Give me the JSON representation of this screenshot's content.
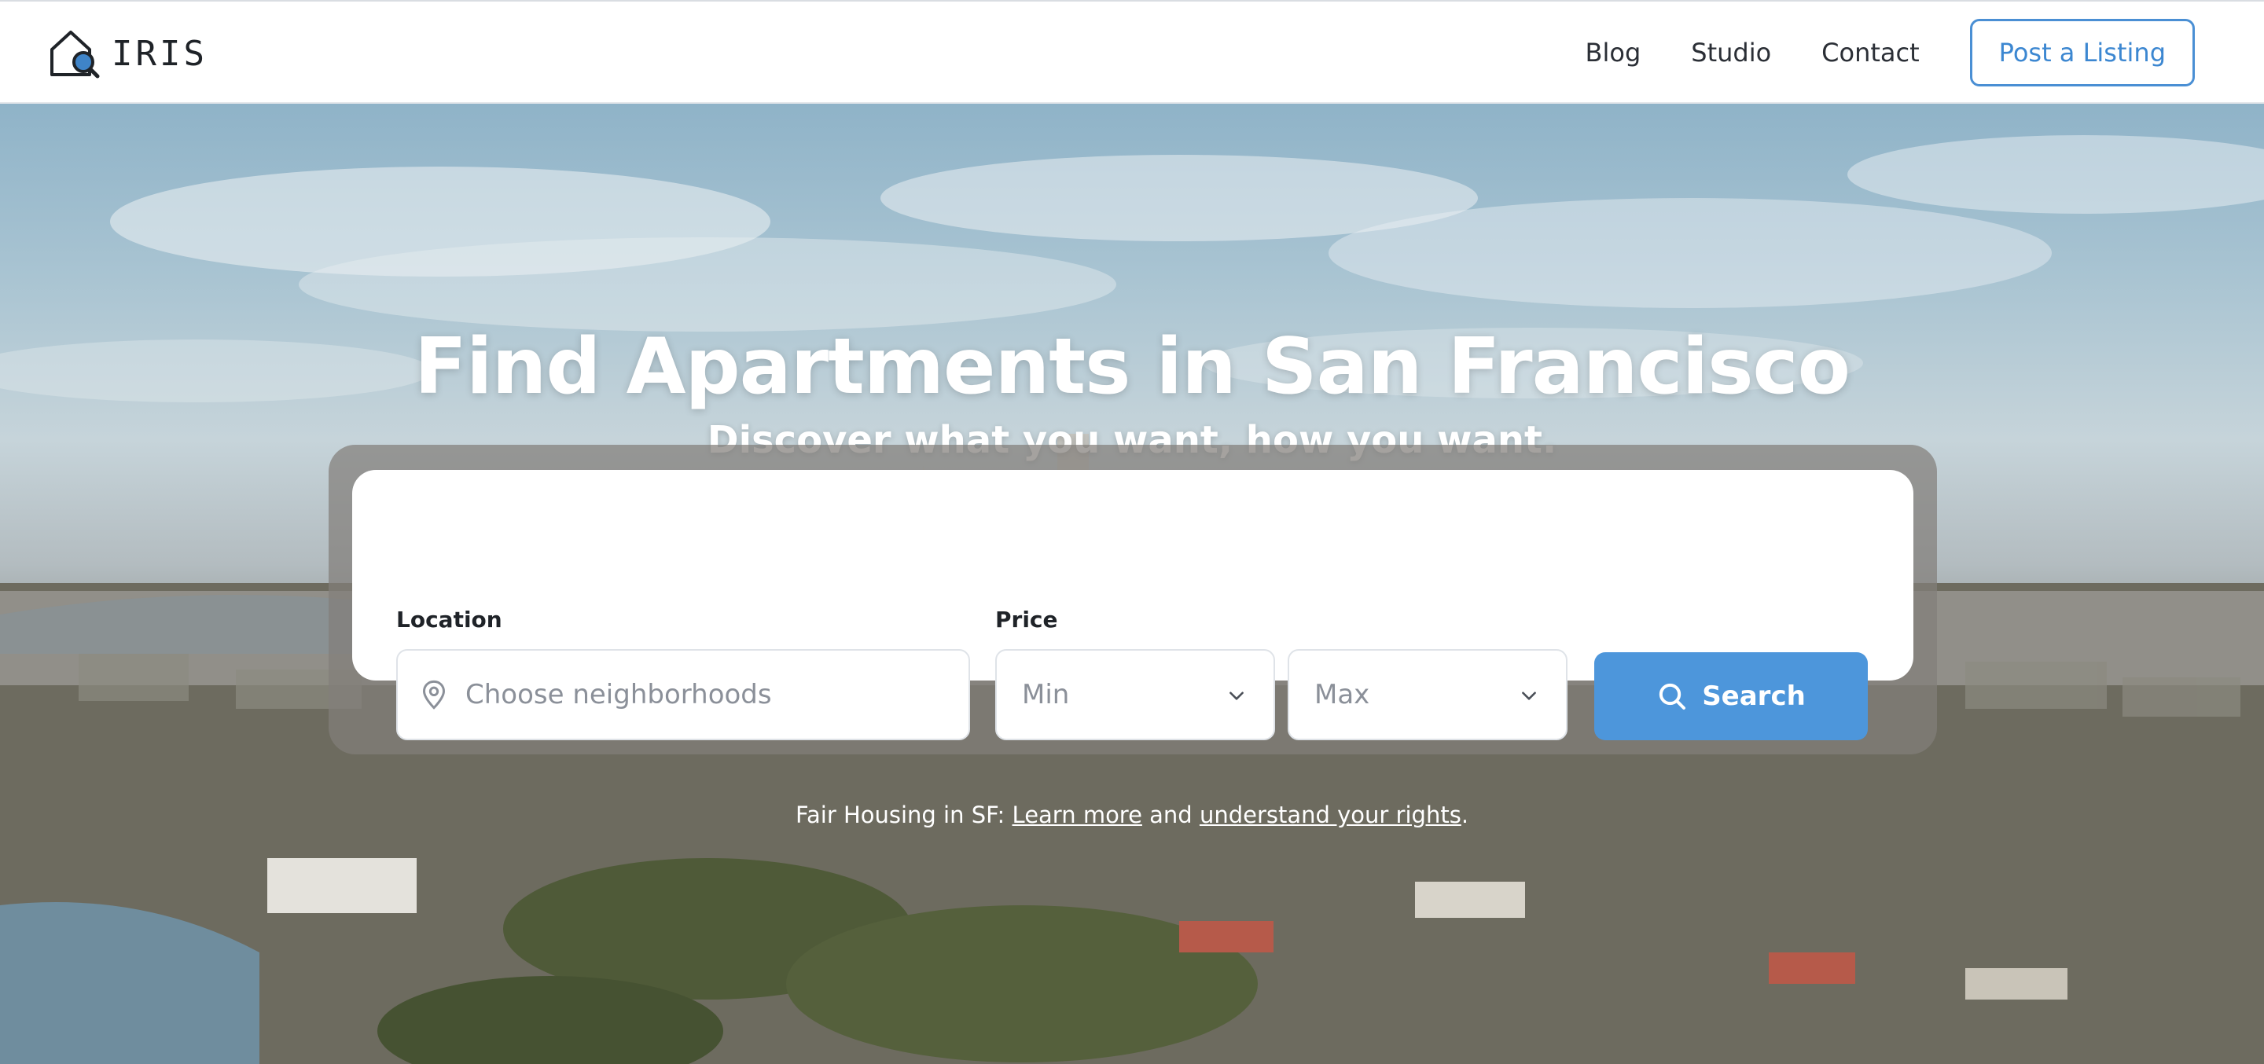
{
  "header": {
    "brand": "IRIS",
    "nav": [
      "Blog",
      "Studio",
      "Contact"
    ],
    "cta": "Post a Listing"
  },
  "hero": {
    "title": "Find Apartments in San Francisco",
    "subtitle": "Discover what you want, how you want."
  },
  "search": {
    "location_label": "Location",
    "location_placeholder": "Choose neighborhoods",
    "price_label": "Price",
    "price_min": "Min",
    "price_max": "Max",
    "button": "Search"
  },
  "fair_housing": {
    "prefix": "Fair Housing in SF: ",
    "learn_more": "Learn more",
    "middle": " and ",
    "rights": "understand your rights",
    "suffix": "."
  },
  "colors": {
    "accent": "#4d96db",
    "cta_border": "#4a8fd4"
  },
  "icons": {
    "logo": "house-search-icon",
    "location": "map-pin-icon",
    "dropdown": "chevron-down-icon",
    "search": "search-icon"
  }
}
